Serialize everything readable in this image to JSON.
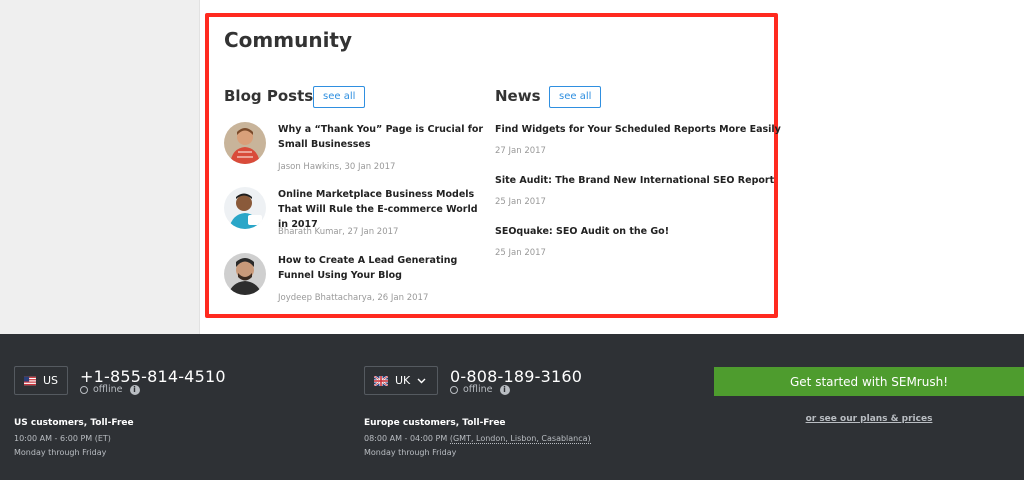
{
  "community": {
    "title": "Community",
    "blog": {
      "heading": "Blog Posts",
      "see_all": "see all",
      "posts": [
        {
          "title": "Why a “Thank You” Page is Crucial for Small Businesses",
          "meta": "Jason Hawkins, 30 Jan 2017"
        },
        {
          "title": "Online Marketplace Business Models That Will Rule the E-commerce World in 2017",
          "meta": "Bharath Kumar, 27 Jan 2017"
        },
        {
          "title": "How to Create A Lead Generating Funnel Using Your Blog",
          "meta": "Joydeep Bhattacharya, 26 Jan 2017"
        }
      ]
    },
    "news": {
      "heading": "News",
      "see_all": "see all",
      "items": [
        {
          "title": "Find Widgets for Your Scheduled Reports More Easily",
          "date": "27 Jan 2017"
        },
        {
          "title": "Site Audit: The Brand New International SEO Report",
          "date": "25 Jan 2017"
        },
        {
          "title": "SEOquake: SEO Audit on the Go!",
          "date": "25 Jan 2017"
        }
      ]
    }
  },
  "footer": {
    "us": {
      "country": "US",
      "phone": "+1-855-814-4510",
      "status": "offline",
      "label": "US customers, Toll-Free",
      "hours": "10:00 AM - 6:00 PM (ET)",
      "days": "Monday through Friday"
    },
    "uk": {
      "country": "UK",
      "phone": "0-808-189-3160",
      "status": "offline",
      "label": "Europe customers, Toll-Free",
      "hours": "08:00 AM - 04:00 PM",
      "timezone": "(GMT, London, Lisbon, Casablanca)",
      "days": "Monday through Friday"
    },
    "cta": "Get started with SEMrush!",
    "plans_link": "or see our plans & prices"
  },
  "colors": {
    "highlight": "#ff2a1f",
    "link": "#2f8fe0",
    "footer_bg": "#2e3135",
    "cta_bg": "#4e9c2e"
  }
}
